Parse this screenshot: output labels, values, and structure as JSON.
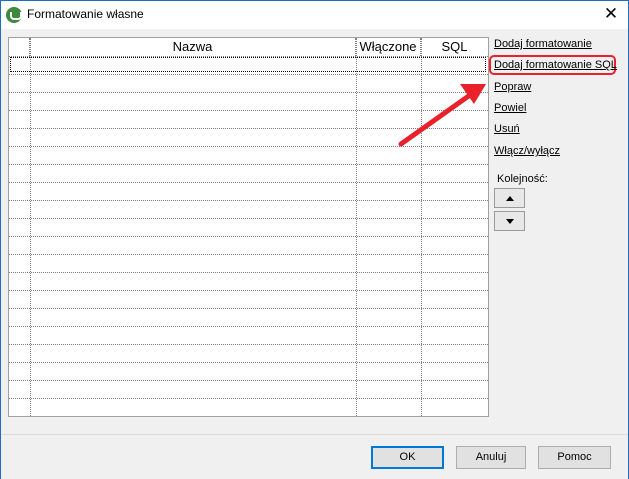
{
  "window": {
    "title": "Formatowanie własne",
    "close_label": "✕"
  },
  "grid": {
    "columns": [
      "",
      "Nazwa",
      "Włączone",
      "SQL"
    ],
    "row_count": 20
  },
  "actions": {
    "add": "Dodaj formatowanie",
    "add_sql": "Dodaj formatowanie SQL",
    "edit": "Popraw",
    "duplicate": "Powiel",
    "delete": "Usuń",
    "toggle": "Włącz/wyłącz"
  },
  "order": {
    "label": "Kolejność:"
  },
  "footer": {
    "ok": "OK",
    "cancel": "Anuluj",
    "help": "Pomoc"
  },
  "colors": {
    "annotation": "#e8212b",
    "accent": "#0078d7"
  }
}
